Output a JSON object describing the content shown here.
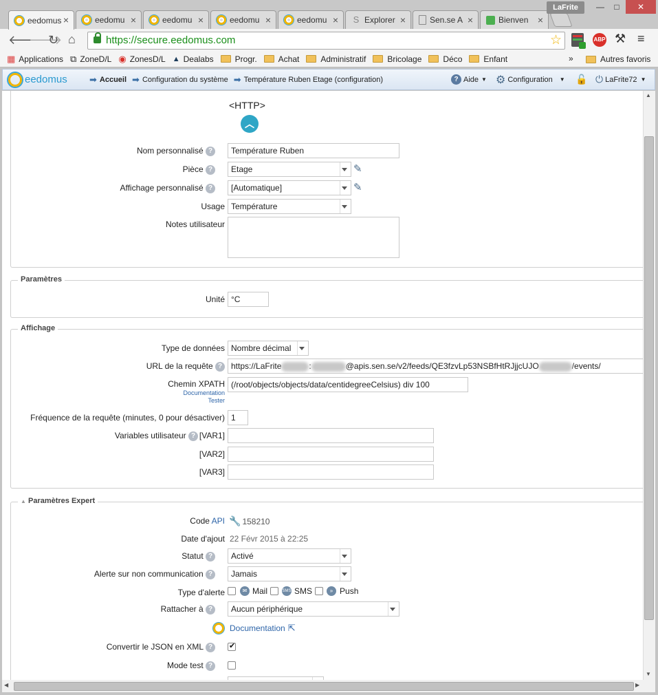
{
  "browser": {
    "tabs": [
      {
        "label": "eedomus",
        "icon": "eedomus-favicon",
        "active": true
      },
      {
        "label": "eedomu",
        "icon": "eedomus-favicon"
      },
      {
        "label": "eedomu",
        "icon": "eedomus-favicon"
      },
      {
        "label": "eedomu",
        "icon": "eedomus-favicon"
      },
      {
        "label": "eedomu",
        "icon": "eedomus-favicon"
      },
      {
        "label": "Explorer",
        "icon": "s-favicon"
      },
      {
        "label": "Sen.se A",
        "icon": "document-favicon"
      },
      {
        "label": "Bienven",
        "icon": "green-favicon"
      }
    ],
    "user_badge": "LaFrite",
    "url": "https://secure.eedomus.com",
    "bookmarks": [
      {
        "label": "Applications",
        "icon": "apps-grid-icon"
      },
      {
        "label": "ZoneD/L",
        "icon": "zone-icon"
      },
      {
        "label": "ZonesD/L",
        "icon": "zones-icon"
      },
      {
        "label": "Dealabs",
        "icon": "dealabs-icon"
      },
      {
        "label": "Progr.",
        "icon": "folder-icon"
      },
      {
        "label": "Achat",
        "icon": "folder-icon"
      },
      {
        "label": "Administratif",
        "icon": "folder-icon"
      },
      {
        "label": "Bricolage",
        "icon": "folder-icon"
      },
      {
        "label": "Déco",
        "icon": "folder-icon"
      },
      {
        "label": "Enfant",
        "icon": "folder-icon"
      }
    ],
    "bookmarks_more": "»",
    "other_bookmarks": "Autres favoris"
  },
  "app": {
    "logo_text": "eedomus",
    "breadcrumbs": [
      "Accueil",
      "Configuration du système",
      "Température Ruben Etage (configuration)"
    ],
    "help_menu": "Aide",
    "config_menu": "Configuration",
    "user_menu": "LaFrite72"
  },
  "form": {
    "section_title": "<HTTP>",
    "nom_label": "Nom personnalisé",
    "nom_value": "Température Ruben",
    "piece_label": "Pièce",
    "piece_value": "Etage",
    "affichage_label": "Affichage personnalisé",
    "affichage_value": "[Automatique]",
    "usage_label": "Usage",
    "usage_value": "Température",
    "notes_label": "Notes utilisateur",
    "notes_value": "",
    "parametres_legend": "Paramètres",
    "unite_label": "Unité",
    "unite_value": "°C",
    "affichage_legend": "Affichage",
    "type_label": "Type de données",
    "type_value": "Nombre décimal",
    "url_label": "URL de la requête",
    "url_prefix": "https://LaFrite",
    "url_sep": ":",
    "url_middle": "@apis.sen.se/v2/feeds/QE3fzvLp53NSBfHtRJjjcUJO",
    "url_suffix": "/events/",
    "xpath_label": "Chemin XPATH",
    "xpath_doc": "Documentation",
    "xpath_tester": "Tester",
    "xpath_value": "(/root/objects/objects/data/centidegreeCelsius) div 100",
    "freq_label": "Fréquence de la requête (minutes, 0 pour désactiver)",
    "freq_value": "1",
    "vars_label": "Variables utilisateur",
    "var1": "[VAR1]",
    "var2": "[VAR2]",
    "var3": "[VAR3]",
    "expert_legend": "Paramètres Expert",
    "code_label": "Code",
    "code_api": "API",
    "code_value": "158210",
    "date_label": "Date d'ajout",
    "date_value": "22 Févr 2015 à 22:25",
    "statut_label": "Statut",
    "statut_value": "Activé",
    "alerte_label": "Alerte sur non communication",
    "alerte_value": "Jamais",
    "type_alerte_label": "Type d'alerte",
    "mail_label": "Mail",
    "sms_label": "SMS",
    "push_label": "Push",
    "rattacher_label": "Rattacher à",
    "rattacher_value": "Aucun périphérique",
    "documentation_link": "Documentation",
    "json_label": "Convertir le JSON en XML",
    "json_checked": true,
    "mode_test_label": "Mode test",
    "mode_test_checked": false
  }
}
